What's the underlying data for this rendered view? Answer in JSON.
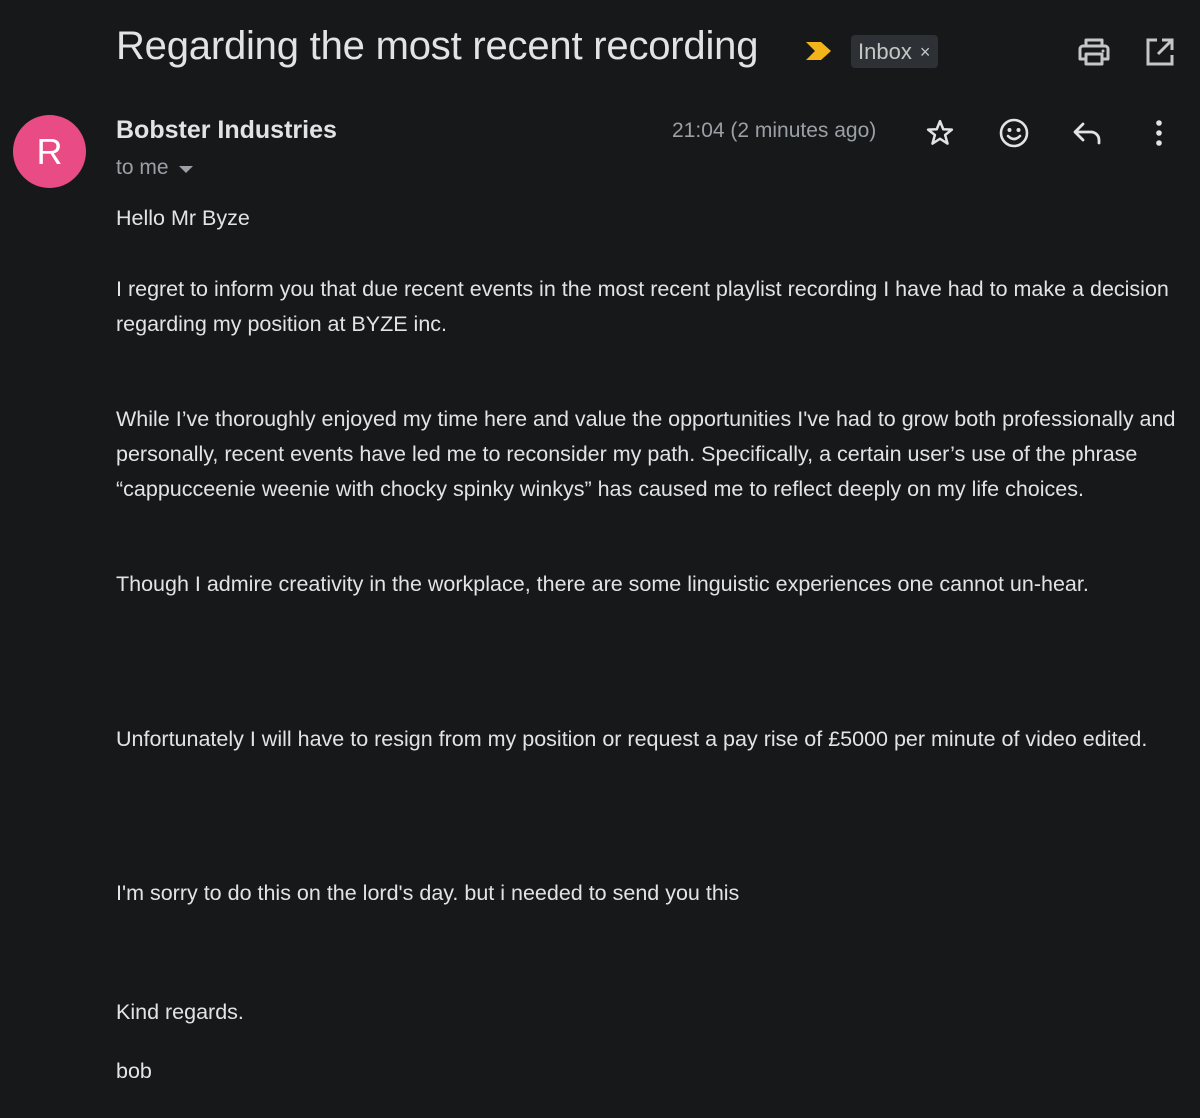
{
  "email": {
    "subject": "Regarding the most recent recording",
    "label": "Inbox",
    "label_remove": "×",
    "sender": "Bobster Industries",
    "sender_initial": "R",
    "recipient": "to me",
    "timestamp": "21:04 (2 minutes ago)",
    "body": [
      "Hello Mr Byze",
      "I regret to inform you that due recent events in the most recent playlist recording I have had to make a decision regarding my position at BYZE inc.",
      "While I’ve thoroughly enjoyed my time here and value the opportunities I've had to grow both professionally and personally, recent events have led me to reconsider my path. Specifically, a certain user’s use of the phrase “cappucceenie weenie with chocky spinky winkys” has caused me to reflect deeply on my life choices.",
      "Though I admire creativity in the workplace, there are some linguistic experiences one cannot un-hear.",
      "Unfortunately I will have to resign from my position or request a pay rise of £5000 per minute of video edited.",
      "I'm sorry to do this on the lord's day. but i needed to send you this",
      "Kind regards.",
      "bob"
    ]
  },
  "icons": {
    "importance": "importance-marker-icon",
    "print": "print-icon",
    "open_new_window": "open-in-new-window-icon",
    "star": "star-icon",
    "emoji": "emoji-reaction-icon",
    "reply": "reply-icon",
    "more": "more-vertical-icon"
  },
  "colors": {
    "background": "#17181a",
    "avatar": "#e94b84",
    "importance": "#f2b418",
    "chip": "#2d3034",
    "text": "#e3e3e3",
    "muted": "#9aa0a6"
  }
}
